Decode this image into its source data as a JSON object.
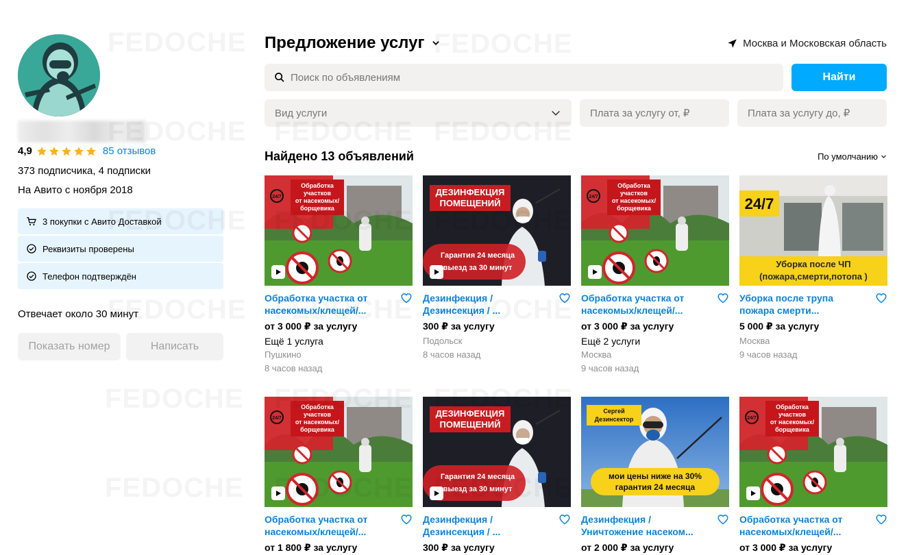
{
  "seller": {
    "rating": "4,9",
    "reviews": "85 отзывов",
    "subscribers": "373 подписчика, 4 подписки",
    "since": "На Авито с ноября 2018",
    "badges": [
      {
        "icon": "cart-icon",
        "label": "3 покупки с Авито Доставкой"
      },
      {
        "icon": "check-circle-icon",
        "label": "Реквизиты проверены"
      },
      {
        "icon": "check-circle-icon",
        "label": "Телефон подтверждён"
      }
    ],
    "responds": "Отвечает около 30 минут",
    "show_phone": "Показать номер",
    "write": "Написать"
  },
  "header": {
    "title": "Предложение услуг",
    "location": "Москва и Московская область"
  },
  "search": {
    "placeholder": "Поиск по объявлениям",
    "button": "Найти"
  },
  "filters": {
    "service_type": "Вид услуги",
    "price_from": "Плата за услугу от, ₽",
    "price_to": "Плата за услугу до, ₽"
  },
  "results": {
    "found": "Найдено 13 объявлений",
    "sort": "По умолчанию"
  },
  "listings": [
    {
      "title": "Обработка участка от насекомых/клещей/...",
      "price": "от 3 000 ₽ за услугу",
      "extra": "Ещё 1 услуга",
      "place": "Пушкино",
      "time": "8 часов назад",
      "image": "garden"
    },
    {
      "title": "Дезинфекция / Дезинсекция / ...",
      "price": "300 ₽ за услугу",
      "extra": "",
      "place": "Подольск",
      "time": "8 часов назад",
      "image": "disinfect"
    },
    {
      "title": "Обработка участка от насекомых/клещей/...",
      "price": "от 3 000 ₽ за услугу",
      "extra": "Ещё 2 услуги",
      "place": "Москва",
      "time": "9 часов назад",
      "image": "garden"
    },
    {
      "title": "Уборка после трупа пожара смерти...",
      "price": "5 000 ₽ за услугу",
      "extra": "",
      "place": "Москва",
      "time": "9 часов назад",
      "image": "cleanup"
    },
    {
      "title": "Обработка участка от насекомых/клещей/...",
      "price": "от 1 800 ₽ за услугу",
      "extra": "",
      "place": "",
      "time": "",
      "image": "garden"
    },
    {
      "title": "Дезинфекция / Дезинсекция / ...",
      "price": "300 ₽ за услугу",
      "extra": "",
      "place": "",
      "time": "",
      "image": "disinfect"
    },
    {
      "title": "Дезинфекция / Уничтожение насеком...",
      "price": "от 2 000 ₽ за услугу",
      "extra": "",
      "place": "",
      "time": "",
      "image": "sergey"
    },
    {
      "title": "Обработка участка от насекомых/клещей/...",
      "price": "от 3 000 ₽ за услугу",
      "extra": "",
      "place": "",
      "time": "",
      "image": "garden"
    }
  ],
  "images": {
    "garden": {
      "line1": "Обработка",
      "line2": "участков",
      "line3": "от насекомых/",
      "line4": "борщевика",
      "badge": "24/7"
    },
    "disinfect": {
      "line1": "ДЕЗИНФЕКЦИЯ",
      "line2": "ПОМЕЩЕНИЙ",
      "line3": "Гарантия 24 месяца",
      "line4": "выезд за 30 минут"
    },
    "cleanup": {
      "line1": "24/7",
      "line2": "Уборка после  ЧП",
      "line3": "(пожара,смерти,потопа )"
    },
    "sergey": {
      "line1": "Сергей",
      "line2": "Дезинсектор",
      "line3": "мои цены ниже на 30%",
      "line4": "гарантия 24 месяца"
    }
  },
  "watermark": "FEDOCHE",
  "colors": {
    "accent": "#00aaff",
    "link": "#0b83d9",
    "badge_bg": "#e6f4fd",
    "star": "#ffb021"
  }
}
